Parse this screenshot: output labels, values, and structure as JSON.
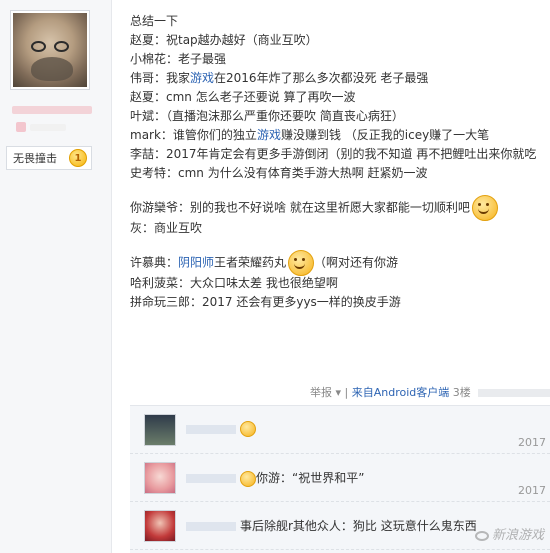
{
  "user_panel": {
    "badge_label": "无畏撞击",
    "badge_level": "1"
  },
  "post": {
    "heading": "总结一下",
    "lines": [
      "赵夏：祝tap越办越好（商业互吹）",
      "小棉花：老子最强",
      "伟哥：我家游戏在2016年炸了那么多次都没死 老子最强",
      "赵夏：cmn 怎么老子还要说 算了再吹一波",
      "叶斌：（直播泡沫那么严重你还要吹 简直丧心病狂）",
      "mark：谁管你们的独立游戏赚没赚到钱 （反正我的icey赚了一大笔",
      "李喆：2017年肯定会有更多手游倒闭（别的我不知道 再不把鲤吐出来你就吃",
      "史考特：cmn 为什么没有体育类手游大热啊 赶紧奶一波"
    ],
    "group2": [
      "你游欒爷：别的我也不好说啥 就在这里祈愿大家都能一切顺利吧",
      "灰：商业互吹"
    ],
    "group3": [
      "许慕典：阴阳师王者荣耀药丸",
      "哈利菠菜：大众口味太差 我也很绝望啊",
      "拼命玩三郎：2017 还会有更多yys一样的换皮手游"
    ],
    "g3_tail": "（啊对还有你游",
    "link_word": "游戏",
    "link_word2": "阴阳师"
  },
  "footer": {
    "report": "举报",
    "separator": "|",
    "source": "来自Android客户端",
    "floor": "3楼"
  },
  "replies": [
    {
      "text": "",
      "date": "2017"
    },
    {
      "text": "你游：“祝世界和平”",
      "date": "2017"
    },
    {
      "text": "事后除舰r其他众人：狗比 这玩意什么鬼东西",
      "date": ""
    }
  ],
  "watermark": "新浪游戏",
  "colors": {
    "link": "#2d64b3",
    "badge": "#f6b30a",
    "reply_bg": "#f4f6f9"
  }
}
